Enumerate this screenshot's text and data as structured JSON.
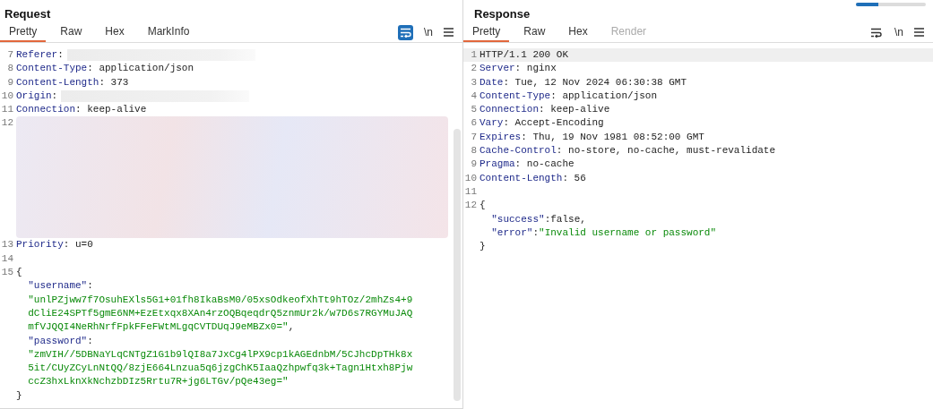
{
  "panels": [
    {
      "title": "Request",
      "tabs": [
        {
          "label": "Pretty",
          "selected": true,
          "disabled": false
        },
        {
          "label": "Raw",
          "selected": false,
          "disabled": false
        },
        {
          "label": "Hex",
          "selected": false,
          "disabled": false
        },
        {
          "label": "MarkInfo",
          "selected": false,
          "disabled": false
        }
      ],
      "wrap_on": true,
      "newline_label": "\\n",
      "scrollbar": true,
      "lines": [
        {
          "num": "7",
          "redacted": true,
          "parts": [
            {
              "kind": "key",
              "text": "Referer"
            },
            {
              "kind": "plain",
              "text": ":"
            }
          ]
        },
        {
          "num": "8",
          "parts": [
            {
              "kind": "key",
              "text": "Content-Type"
            },
            {
              "kind": "plain",
              "text": ": application/json"
            }
          ]
        },
        {
          "num": "9",
          "parts": [
            {
              "kind": "key",
              "text": "Content-Length"
            },
            {
              "kind": "plain",
              "text": ": 373"
            }
          ]
        },
        {
          "num": "10",
          "redacted": true,
          "parts": [
            {
              "kind": "key",
              "text": "Origin"
            },
            {
              "kind": "plain",
              "text": ":"
            }
          ]
        },
        {
          "num": "11",
          "parts": [
            {
              "kind": "key",
              "text": "Connection"
            },
            {
              "kind": "plain",
              "text": ": keep-alive"
            }
          ]
        },
        {
          "num": "12",
          "block": true
        },
        {
          "num": "13",
          "parts": [
            {
              "kind": "key",
              "text": "Priority"
            },
            {
              "kind": "plain",
              "text": ": u=0"
            }
          ]
        },
        {
          "num": "14"
        },
        {
          "num": "15",
          "parts": [
            {
              "kind": "plain",
              "text": "{"
            }
          ]
        },
        {
          "parts": [
            {
              "kind": "jsonkey",
              "text": "  \"username\""
            },
            {
              "kind": "plain",
              "text": ":"
            }
          ]
        },
        {
          "parts": [
            {
              "kind": "string",
              "text": "  \"unlPZjww7f7OsuhEXls5G1+01fh8IkaBsM0/05xsOdkeofXhTt9hTOz/2mhZs4+9"
            }
          ]
        },
        {
          "parts": [
            {
              "kind": "string",
              "text": "  dCliE24SPTf5gmE6NM+EzEtxqx8XAn4rzOQBqeqdrQ5znmUr2k/w7D6s7RGYMuJAQ"
            }
          ]
        },
        {
          "parts": [
            {
              "kind": "string",
              "text": "  mfVJQQI4NeRhNrfFpkFFeFWtMLgqCVTDUqJ9eMBZx0=\""
            },
            {
              "kind": "plain",
              "text": ","
            }
          ]
        },
        {
          "parts": [
            {
              "kind": "jsonkey",
              "text": "  \"password\""
            },
            {
              "kind": "plain",
              "text": ":"
            }
          ]
        },
        {
          "parts": [
            {
              "kind": "string",
              "text": "  \"zmVIH//5DBNaYLqCNTgZ1G1b9lQI8a7JxCg4lPX9cp1kAGEdnbM/5CJhcDpTHk8x"
            }
          ]
        },
        {
          "parts": [
            {
              "kind": "string",
              "text": "  5it/CUyZCyLnNtQQ/8zjE664Lnzua5q6jzgChK5IaaQzhpwfq3k+Tagn1Htxh8Pjw"
            }
          ]
        },
        {
          "parts": [
            {
              "kind": "string",
              "text": "  ccZ3hxLknXkNchzbDIz5Rrtu7R+jg6LTGv/pQe43eg=\""
            }
          ]
        },
        {
          "parts": [
            {
              "kind": "plain",
              "text": "}"
            }
          ]
        }
      ]
    },
    {
      "title": "Response",
      "tabs": [
        {
          "label": "Pretty",
          "selected": true,
          "disabled": false
        },
        {
          "label": "Raw",
          "selected": false,
          "disabled": false
        },
        {
          "label": "Hex",
          "selected": false,
          "disabled": false
        },
        {
          "label": "Render",
          "selected": false,
          "disabled": true
        }
      ],
      "wrap_on": false,
      "newline_label": "\\n",
      "lines": [
        {
          "num": "1",
          "parts": [
            {
              "kind": "plain",
              "text": "HTTP/1.1 200 OK"
            }
          ]
        },
        {
          "num": "2",
          "parts": [
            {
              "kind": "key",
              "text": "Server"
            },
            {
              "kind": "plain",
              "text": ": nginx"
            }
          ]
        },
        {
          "num": "3",
          "parts": [
            {
              "kind": "key",
              "text": "Date"
            },
            {
              "kind": "plain",
              "text": ": Tue, 12 Nov 2024 06:30:38 GMT"
            }
          ]
        },
        {
          "num": "4",
          "parts": [
            {
              "kind": "key",
              "text": "Content-Type"
            },
            {
              "kind": "plain",
              "text": ": application/json"
            }
          ]
        },
        {
          "num": "5",
          "parts": [
            {
              "kind": "key",
              "text": "Connection"
            },
            {
              "kind": "plain",
              "text": ": keep-alive"
            }
          ]
        },
        {
          "num": "6",
          "parts": [
            {
              "kind": "key",
              "text": "Vary"
            },
            {
              "kind": "plain",
              "text": ": Accept-Encoding"
            }
          ]
        },
        {
          "num": "7",
          "parts": [
            {
              "kind": "key",
              "text": "Expires"
            },
            {
              "kind": "plain",
              "text": ": Thu, 19 Nov 1981 08:52:00 GMT"
            }
          ]
        },
        {
          "num": "8",
          "parts": [
            {
              "kind": "key",
              "text": "Cache-Control"
            },
            {
              "kind": "plain",
              "text": ": no-store, no-cache, must-revalidate"
            }
          ]
        },
        {
          "num": "9",
          "parts": [
            {
              "kind": "key",
              "text": "Pragma"
            },
            {
              "kind": "plain",
              "text": ": no-cache"
            }
          ]
        },
        {
          "num": "10",
          "parts": [
            {
              "kind": "key",
              "text": "Content-Length"
            },
            {
              "kind": "plain",
              "text": ": 56"
            }
          ]
        },
        {
          "num": "11"
        },
        {
          "num": "12",
          "parts": [
            {
              "kind": "plain",
              "text": "{"
            }
          ]
        },
        {
          "parts": [
            {
              "kind": "jsonkey",
              "text": "  \"success\""
            },
            {
              "kind": "plain",
              "text": ":false,"
            }
          ]
        },
        {
          "parts": [
            {
              "kind": "jsonkey",
              "text": "  \"error\""
            },
            {
              "kind": "plain",
              "text": ":"
            },
            {
              "kind": "string",
              "text": "\"Invalid username or password\""
            }
          ]
        },
        {
          "parts": [
            {
              "kind": "plain",
              "text": "}"
            }
          ]
        }
      ]
    }
  ]
}
